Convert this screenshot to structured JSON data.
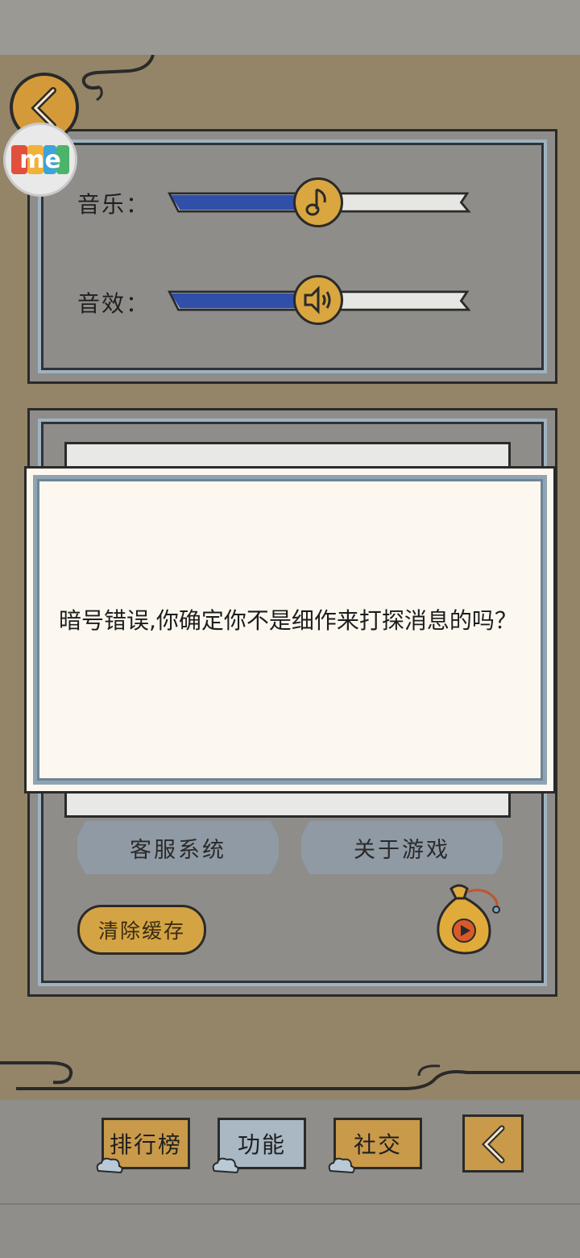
{
  "settings": {
    "music_label": "音乐：",
    "music_level": 0.5,
    "sfx_label": "音效：",
    "sfx_level": 0.5
  },
  "dialog": {
    "message": "暗号错误,你确定你不是细作来打探消息的吗？"
  },
  "buttons": {
    "customer_service": "客服系统",
    "about_game": "关于游戏",
    "clear_cache": "清除缓存"
  },
  "tabs": [
    {
      "label": "排行榜",
      "active": false
    },
    {
      "label": "功能",
      "active": true
    },
    {
      "label": "社交",
      "active": false
    }
  ],
  "logo": {
    "text": "me"
  },
  "colors": {
    "accent_gold": "#d9a640",
    "slider_blue": "#2f4fa8",
    "panel_gray": "#8e8d8a",
    "scene_tan": "#948568",
    "dialog_bg": "#fdf8ef"
  }
}
